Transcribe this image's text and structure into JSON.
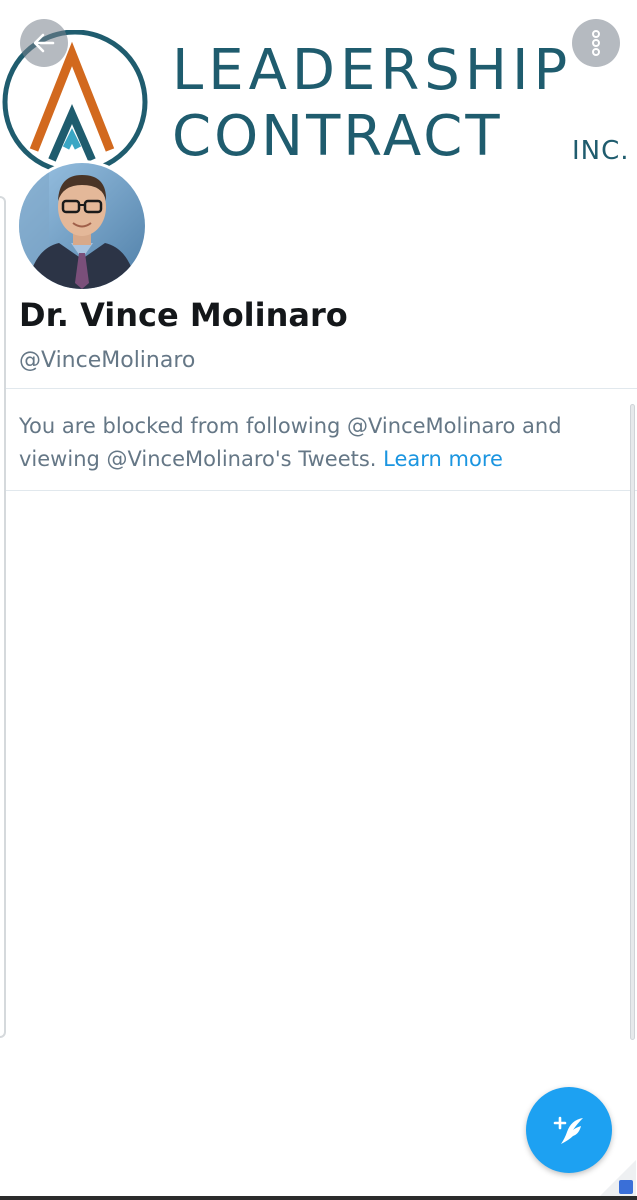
{
  "banner": {
    "line1": "LEADERSHIP",
    "line2": "CONTRACT",
    "suffix": "INC."
  },
  "toolbar": {
    "back_icon": "arrow-left-icon",
    "more_icon": "more-vertical-icon"
  },
  "profile": {
    "display_name": "Dr. Vince Molinaro",
    "handle": "@VinceMolinaro"
  },
  "notice": {
    "text": "You are blocked from following @VinceMolinaro and viewing @VinceMolinaro's Tweets.",
    "link": "Learn more"
  },
  "fab": {
    "icon": "compose-tweet-icon"
  },
  "colors": {
    "accent": "#1da1f2",
    "link": "#1b95e0",
    "brand_teal": "#1f5c6e",
    "brand_orange": "#d2691e",
    "secondary_text": "#657786"
  }
}
